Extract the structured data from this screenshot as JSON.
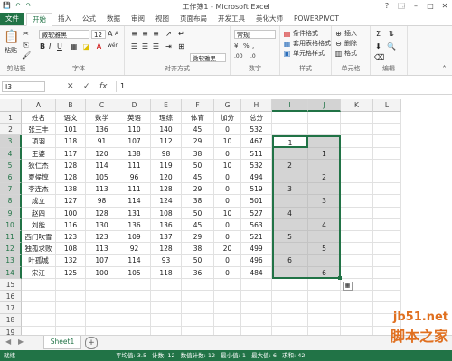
{
  "titlebar": {
    "title": "工作簿1 - Microsoft Excel",
    "qat": [
      "💾",
      "↶",
      "↷"
    ],
    "win": [
      "?",
      "🗔",
      "–",
      "□",
      "✕"
    ]
  },
  "tabs": [
    "文件",
    "开始",
    "插入",
    "公式",
    "数据",
    "审阅",
    "视图",
    "页面布局",
    "开发工具",
    "美化大师",
    "POWERPIVOT"
  ],
  "ribbon": {
    "clipboard": {
      "label": "剪贴板",
      "paste": "粘贴"
    },
    "font": {
      "label": "字体",
      "name": "微软雅黑",
      "size": "12",
      "bold": "B",
      "italic": "I",
      "underline": "U",
      "grow": "A",
      "shrink": "A",
      "wen": "wén"
    },
    "align": {
      "label": "对齐方式"
    },
    "number": {
      "label": "数字",
      "format": "常规",
      "pct": "%",
      "comma": ",",
      "currency": "¥",
      "inc": ".00",
      "dec": ".0"
    },
    "styles": {
      "label": "样式",
      "cond": "条件格式",
      "table": "套用表格格式",
      "cell": "单元格样式"
    },
    "cells": {
      "label": "单元格",
      "insert": "插入",
      "delete": "删除",
      "format": "格式"
    },
    "editing": {
      "label": "编辑"
    },
    "minifont": "微软雅黑"
  },
  "formula": {
    "namebox": "I3",
    "fx": "fx",
    "cancel": "✕",
    "enter": "✓",
    "value": "1"
  },
  "columns": [
    "A",
    "B",
    "C",
    "D",
    "E",
    "F",
    "G",
    "H",
    "I",
    "J",
    "K",
    "L"
  ],
  "rows": [
    "1",
    "2",
    "3",
    "4",
    "5",
    "6",
    "7",
    "8",
    "9",
    "10",
    "11",
    "12",
    "13",
    "14",
    "15",
    "16",
    "17",
    "18",
    "19"
  ],
  "sheet": {
    "r1": [
      "姓名",
      "语文",
      "数学",
      "英语",
      "理综",
      "体育",
      "加分",
      "总分"
    ],
    "r2": [
      "张三丰",
      "101",
      "136",
      "110",
      "140",
      "45",
      "0",
      "532"
    ],
    "r3": [
      "项羽",
      "118",
      "91",
      "107",
      "112",
      "29",
      "10",
      "467",
      "1"
    ],
    "r4": [
      "王婆",
      "117",
      "120",
      "138",
      "98",
      "38",
      "0",
      "511",
      "",
      "1"
    ],
    "r5": [
      "狄仁杰",
      "128",
      "114",
      "111",
      "119",
      "50",
      "10",
      "532",
      "2"
    ],
    "r6": [
      "夏侯惇",
      "128",
      "105",
      "96",
      "120",
      "45",
      "0",
      "494",
      "",
      "2"
    ],
    "r7": [
      "李连杰",
      "138",
      "113",
      "111",
      "128",
      "29",
      "0",
      "519",
      "3"
    ],
    "r8": [
      "成立",
      "127",
      "98",
      "114",
      "124",
      "38",
      "0",
      "501",
      "",
      "3"
    ],
    "r9": [
      "赵四",
      "100",
      "128",
      "131",
      "108",
      "50",
      "10",
      "527",
      "4"
    ],
    "r10": [
      "刘能",
      "116",
      "130",
      "136",
      "136",
      "45",
      "0",
      "563",
      "",
      "4"
    ],
    "r11": [
      "西门吹雪",
      "123",
      "123",
      "109",
      "137",
      "29",
      "0",
      "521",
      "5"
    ],
    "r12": [
      "独孤求败",
      "108",
      "113",
      "92",
      "128",
      "38",
      "20",
      "499",
      "",
      "5"
    ],
    "r13": [
      "叶孤城",
      "132",
      "107",
      "114",
      "93",
      "50",
      "0",
      "496",
      "6"
    ],
    "r14": [
      "宋江",
      "125",
      "100",
      "105",
      "118",
      "36",
      "0",
      "484",
      "",
      "6"
    ]
  },
  "sheettab": "Sheet1",
  "addsheet": "+",
  "nav": [
    "◀",
    "▶"
  ],
  "status": {
    "ready": "就绪",
    "stats": [
      "平均值: 3.5",
      "计数: 12",
      "数值计数: 12",
      "最小值: 1",
      "最大值: 6",
      "求和: 42"
    ]
  },
  "watermark": {
    "site": "jb51.net",
    "name": "脚本之家"
  },
  "colors": {
    "accent": "#217346",
    "selection": "#d4d4d4"
  }
}
